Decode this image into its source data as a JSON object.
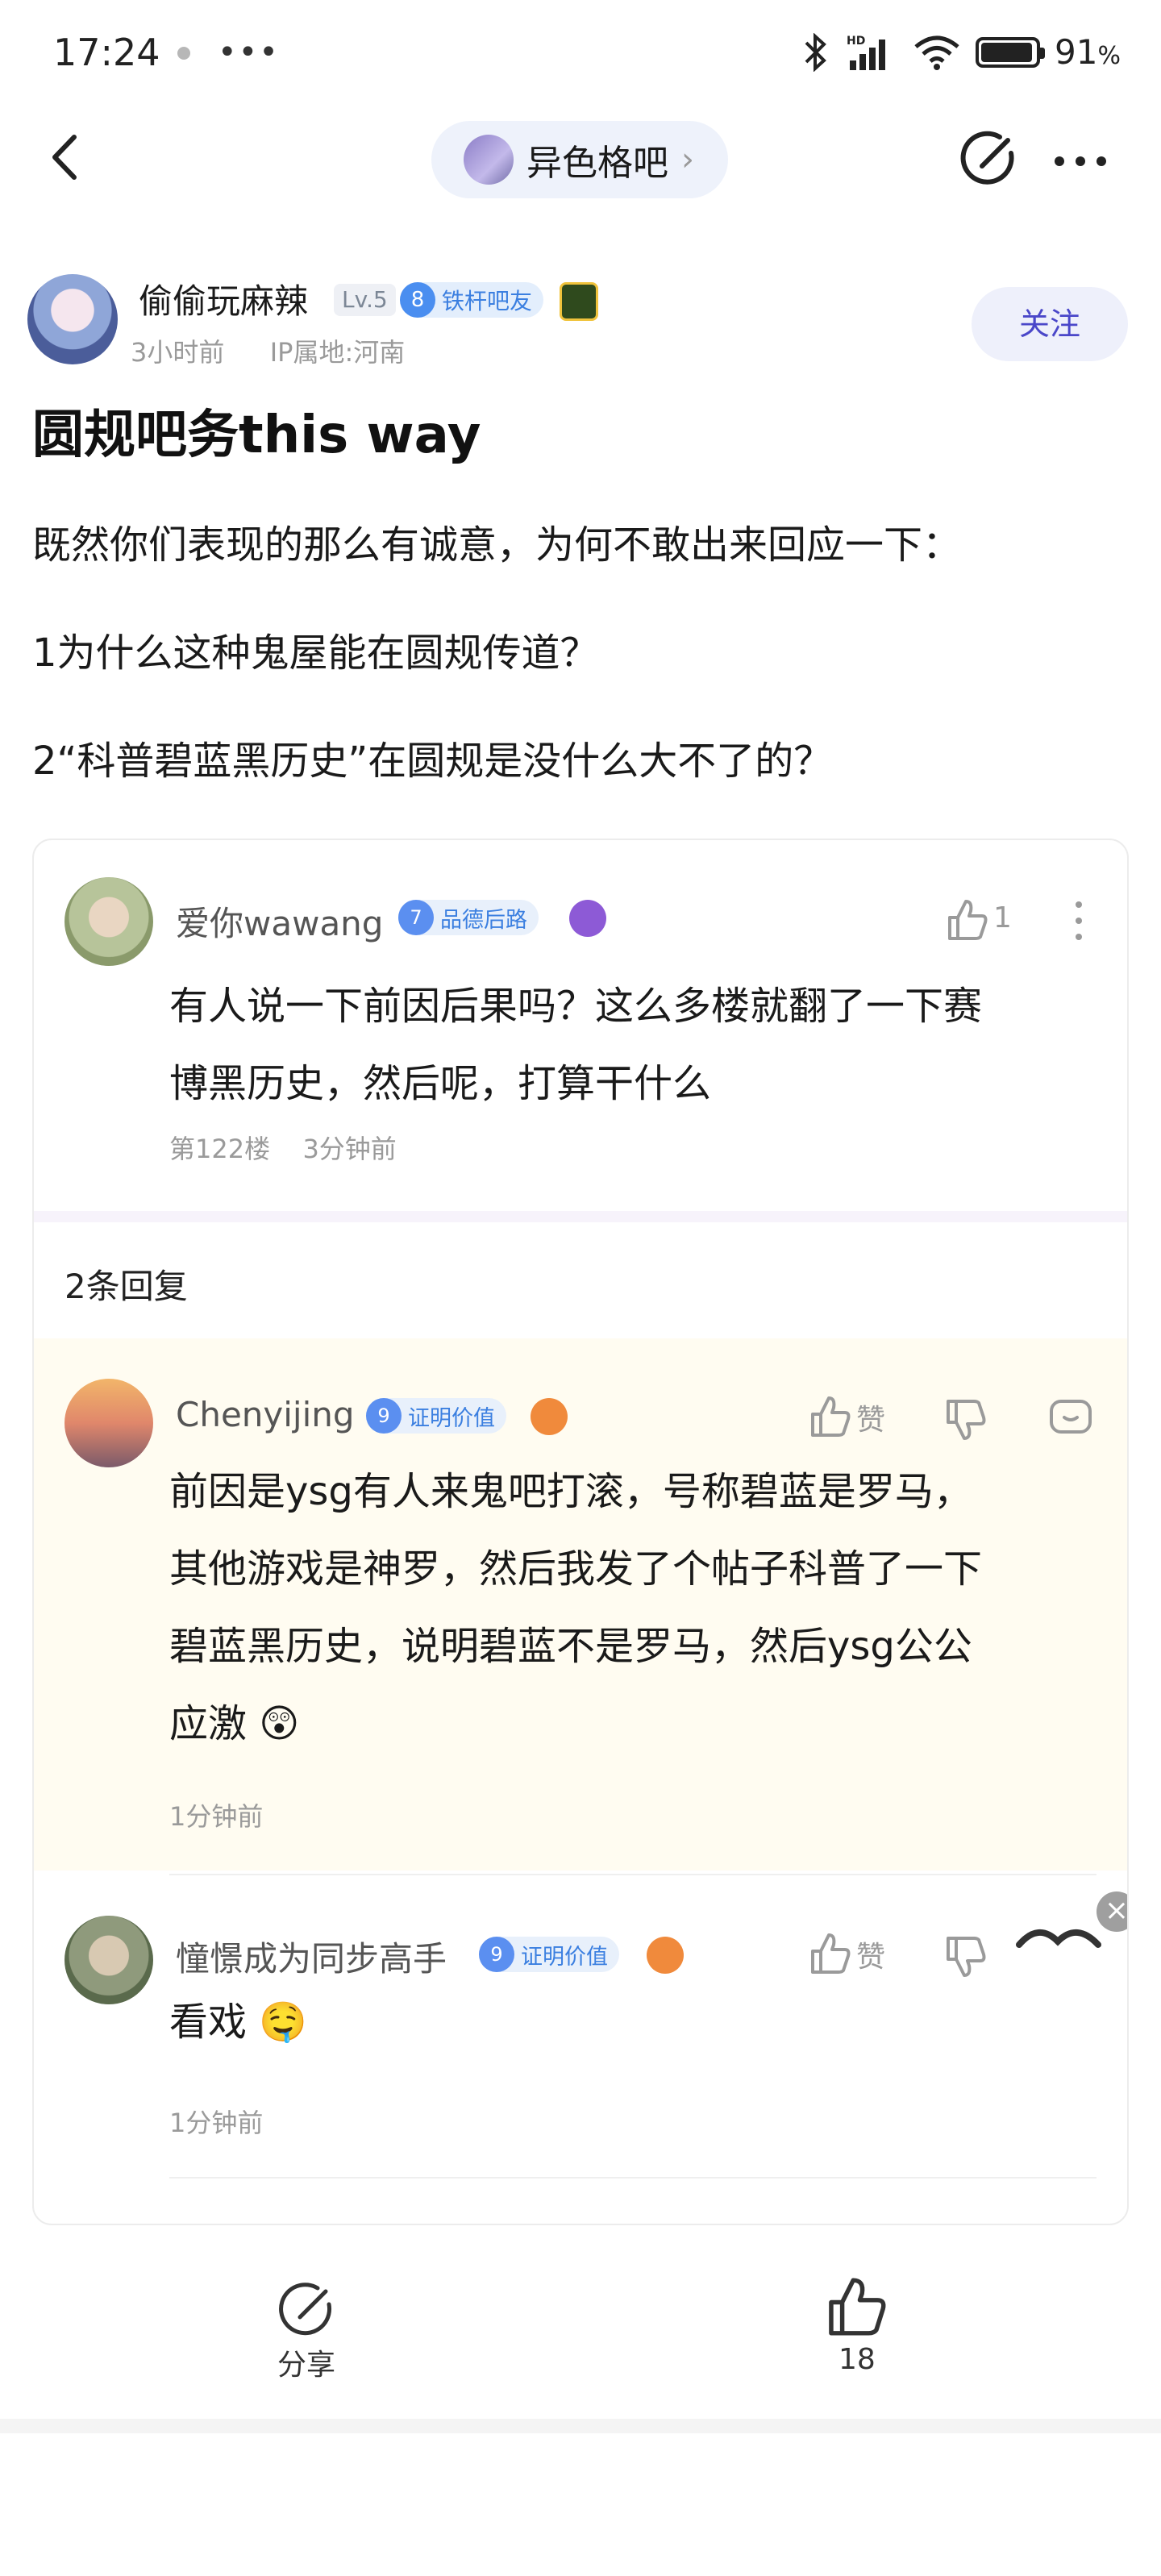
{
  "status_bar": {
    "time": "17:24",
    "more": "•••",
    "battery_pct": "91",
    "battery_unit": "%"
  },
  "nav": {
    "forum_name": "异色格吧"
  },
  "post": {
    "author": "偷偷玩麻辣",
    "level": "Lv.5",
    "badge_level": "8",
    "badge_title": "铁杆吧友",
    "time": "3小时前",
    "ip": "IP属地:河南",
    "follow_label": "关注",
    "title": "圆规吧务this way",
    "paragraphs": [
      "既然你们表现的那么有诚意，为何不敢出来回应一下：",
      "1为什么这种鬼屋能在圆规传道？",
      "2“科普碧蓝黑历史”在圆规是没什么大不了的？"
    ]
  },
  "comment": {
    "author": "爱你wawang",
    "badge_level": "7",
    "badge_title": "品德后路",
    "likes": "1",
    "text_lines": [
      "有人说一下前因后果吗？这么多楼就翻了一下赛",
      "博黑历史，然后呢，打算干什么"
    ],
    "floor": "第122楼",
    "time": "3分钟前",
    "reply_count": "2条回复",
    "replies": [
      {
        "author": "Chenyijing",
        "badge_level": "9",
        "badge_title": "证明价值",
        "like_label": "赞",
        "text_lines": [
          "前因是ysg有人来鬼吧打滚，号称碧蓝是罗马，",
          "其他游戏是神罗，然后我发了个帖子科普了一下",
          "碧蓝黑历史，说明碧蓝不是罗马，然后ysg公公",
          "应激 😲"
        ],
        "time": "1分钟前"
      },
      {
        "author": "憧憬成为同步高手",
        "badge_level": "9",
        "badge_title": "证明价值",
        "like_label": "赞",
        "text_lines": [
          "看戏 🤤"
        ],
        "time": "1分钟前"
      }
    ]
  },
  "bottom_bar": {
    "share_label": "分享",
    "like_count": "18"
  },
  "colors": {
    "accent": "#4a47c9",
    "badge_blue": "#3b7fe0",
    "reply_bg": "#fffcf1"
  }
}
